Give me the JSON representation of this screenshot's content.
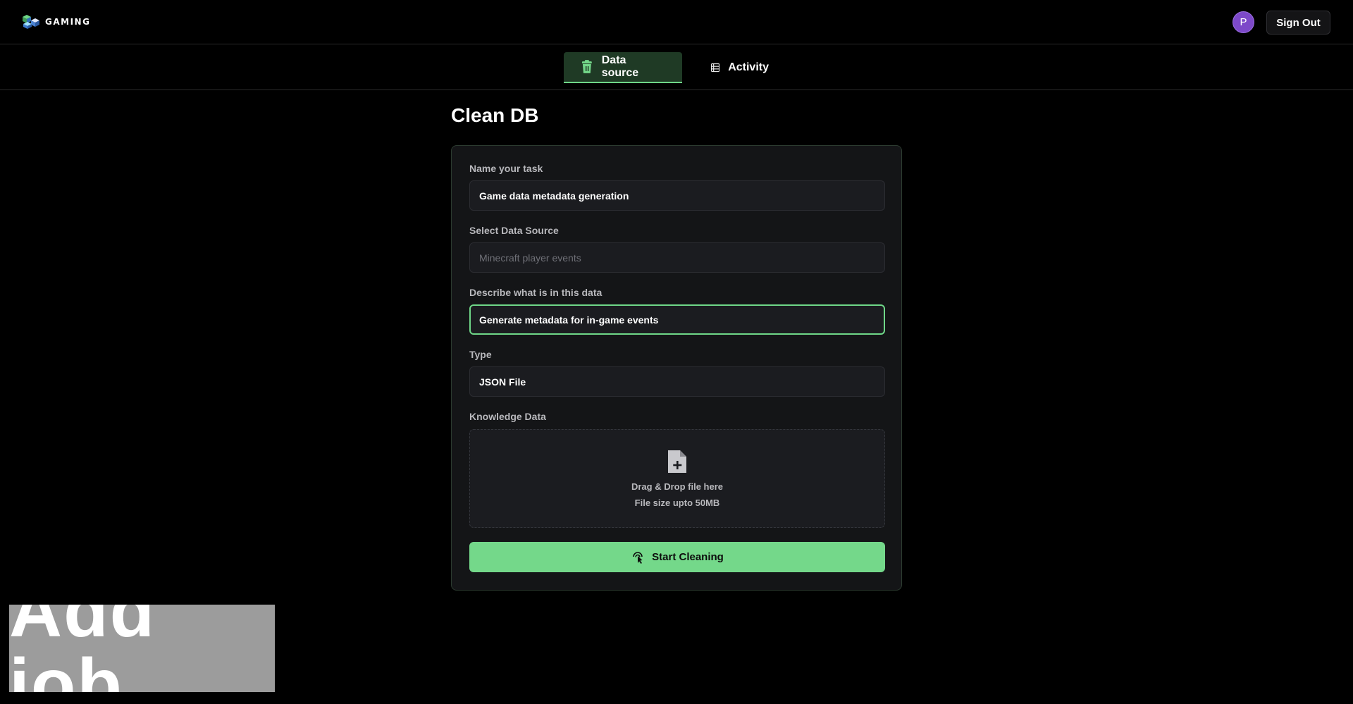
{
  "header": {
    "logo_text": "GAMING",
    "avatar_initial": "P",
    "sign_out_label": "Sign Out"
  },
  "tabs": [
    {
      "label": "Data source",
      "icon": "trash-bin-icon",
      "active": true
    },
    {
      "label": "Activity",
      "icon": "table-list-icon",
      "active": false
    }
  ],
  "page": {
    "title": "Clean DB"
  },
  "form": {
    "task_name": {
      "label": "Name your task",
      "value": "Game data metadata generation"
    },
    "data_source": {
      "label": "Select Data Source",
      "placeholder": "Minecraft player events"
    },
    "description": {
      "label": "Describe what is in this data",
      "value": "Generate metadata for in-game events"
    },
    "type": {
      "label": "Type",
      "value": "JSON File"
    },
    "knowledge": {
      "label": "Knowledge Data",
      "drop_text": "Drag & Drop file here",
      "size_text": "File size upto 50MB"
    },
    "submit_label": "Start Cleaning"
  },
  "overlay": {
    "text": "Add job"
  },
  "colors": {
    "accent": "#74d88a",
    "avatar": "#7d49c9",
    "background": "#000000",
    "card": "#141517"
  }
}
